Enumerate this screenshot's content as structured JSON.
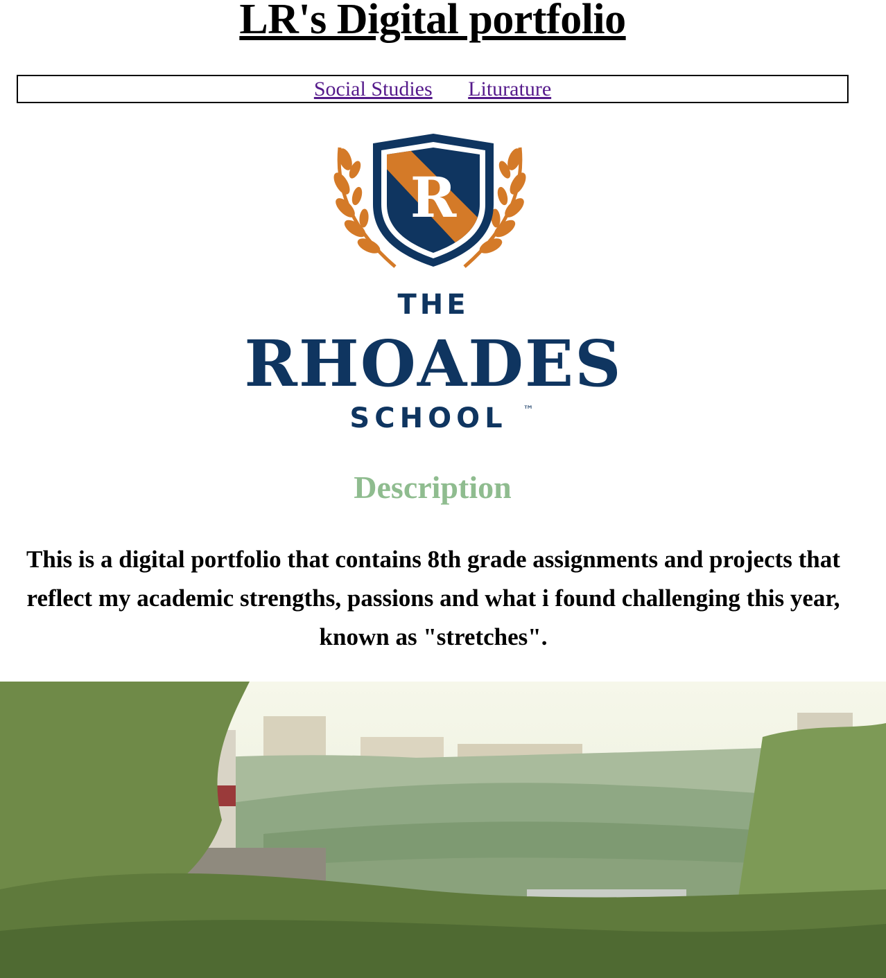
{
  "page": {
    "title": "LR's Digital portfolio"
  },
  "nav": {
    "links": [
      {
        "label": "Social Studies"
      },
      {
        "label": "Liturature"
      }
    ],
    "link_color": "#551a8b"
  },
  "logo": {
    "crest_letter": "R",
    "line1": "THE",
    "line2": "RHOADES",
    "line3": "SCHOOL",
    "trademark": "™",
    "colors": {
      "navy": "#0f3560",
      "orange": "#d47a28"
    }
  },
  "description": {
    "heading": "Description",
    "heading_color": "#8fbc8f",
    "text": "This is a digital portfolio that contains 8th grade assignments and projects that reflect my academic strengths, passions and what i found challenging this year, known as \"stretches\"."
  }
}
